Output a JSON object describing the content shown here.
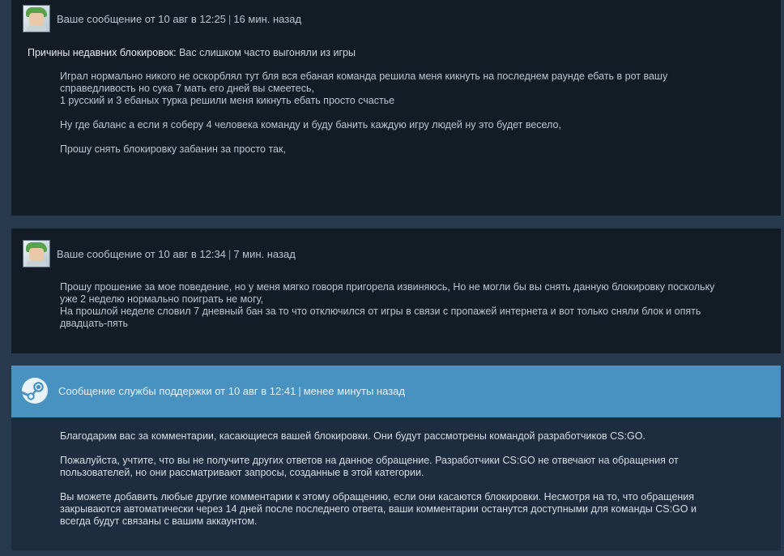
{
  "messages": [
    {
      "header_text": "Ваше сообщение от 10 авг в 12:25",
      "age": "16 мин. назад",
      "reasons_label": "Причины недавних блокировок:",
      "reasons_value": "Вас слишком часто выгоняли из игры",
      "paragraphs": [
        "Играл нормально никого не оскорблял тут бля вся ебаная команда решила меня кикнуть на последнем раунде ебать в рот вашу\nсправедливость но сука 7 мать его дней вы смеетесь,\n1 русский и 3 ебаных турка решили меня кикнуть ебать просто счастье",
        "Ну где баланс а если я соберу 4 человека команду и буду банить каждую игру людей ну это будет весело,",
        "Прошу снять блокировку забанин за просто так,"
      ]
    },
    {
      "header_text": "Ваше сообщение от 10 авг в 12:34",
      "age": "7 мин. назад",
      "paragraphs": [
        "Прошу прошение за мое поведение, но у меня мягко говоря пригорела извиняюсь, Но не могли бы вы снять данную блокировку поскольку\nуже 2 неделю нормально поиграть не могу,\nНа прошлой неделе словил 7 дневный бан за то что отключился от игры в связи с пропажей интернета и вот только сняли блок и опять\nдвадцать-пять"
      ]
    }
  ],
  "support": {
    "header_text": "Сообщение службы поддержки от 10 авг в 12:41",
    "age": "менее минуты назад",
    "paragraphs": [
      "Благодарим вас за комментарии, касающиеся вашей блокировки. Они будут рассмотрены командой разработчиков CS:GO.",
      "Пожалуйста, учтите, что вы не получите других ответов на данное обращение. Разработчики CS:GO не отвечают на обращения от\nпользователей, но они рассматривают запросы, созданные в этой категории.",
      "Вы можете добавить любые другие комментарии к этому обращению, если они касаются блокировки. Несмотря на то, что обращения\nзакрываются автоматически через 14 дней после последнего ответа, ваши комментарии останутся доступными для команды CS:GO и\nвсегда будут связаны с вашим аккаунтом."
    ]
  },
  "separator": "|",
  "icons": {
    "user_avatar": "user-avatar",
    "support_logo": "steam-logo-icon"
  },
  "colors": {
    "page_bg": "#27394d",
    "user_message_bg": "#131b25",
    "support_header_bg": "#4792c1",
    "support_body_bg": "#1d2c3e"
  }
}
